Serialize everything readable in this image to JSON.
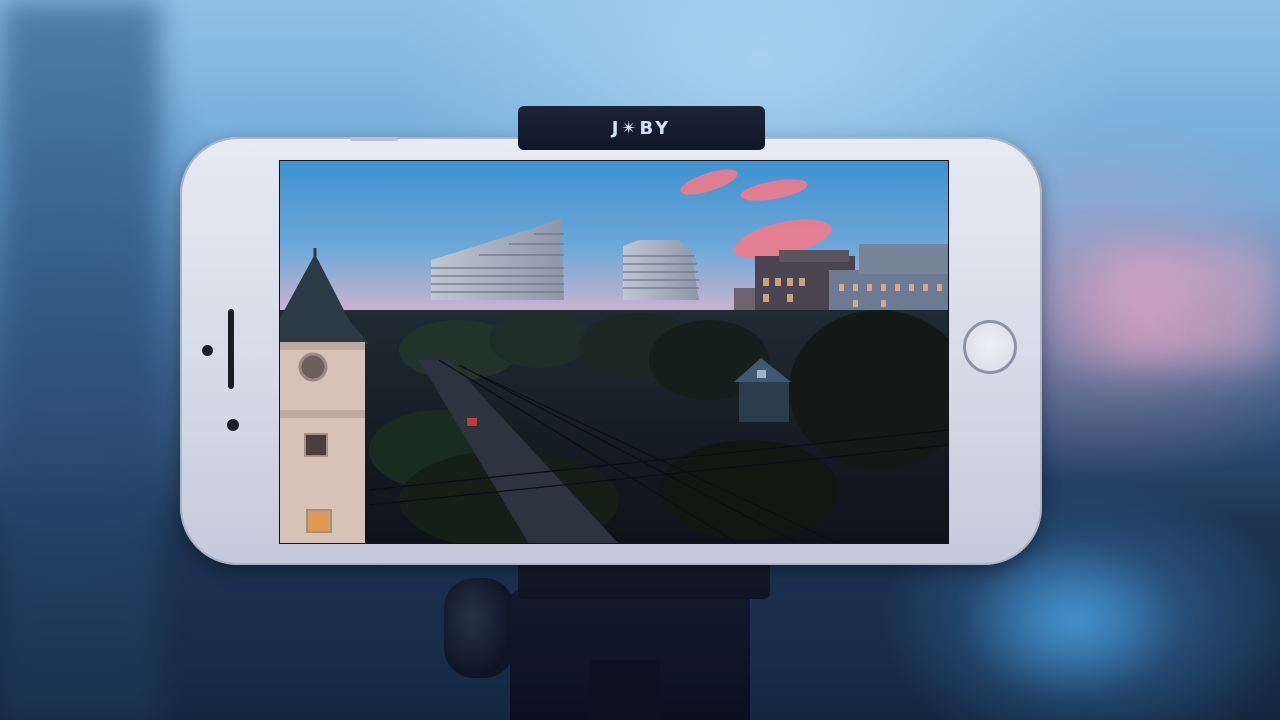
{
  "scene": {
    "description_colors": {
      "sky_top": "#4a9ad6",
      "sky_horizon": "#e7b9c9",
      "cloud": "#f07b8c"
    }
  },
  "tripod": {
    "brand_text": "J✴BY"
  },
  "phone": {
    "icons": [
      "front-camera-icon",
      "earpiece-icon",
      "home-button-icon"
    ]
  }
}
